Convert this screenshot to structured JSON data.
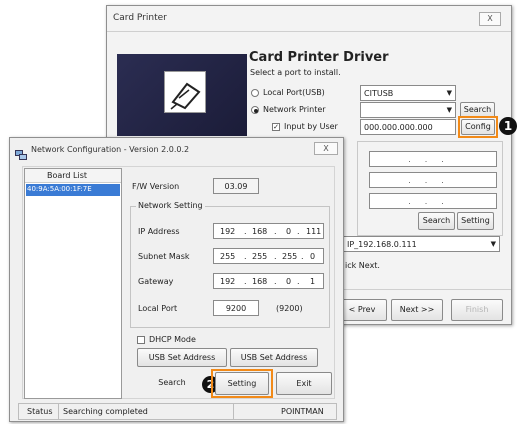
{
  "card_printer": {
    "title": "Card Printer",
    "close": "X",
    "heading": "Card Printer Driver",
    "subheading": "Select a port to install.",
    "local_port_label": "Local Port(USB)",
    "local_port_value": "CITUSB",
    "network_printer_label": "Network Printer",
    "network_printer_value": "",
    "search_button": "Search",
    "input_by_user_label": "Input by User",
    "input_by_user_value": "000.000.000.000",
    "config_button": "Config",
    "search_button_2": "Search",
    "setting_button": "Setting",
    "port_select_value": "IP_192.168.0.111",
    "hint": "ick Next.",
    "prev_button": "< Prev",
    "next_button": "Next >>",
    "finish_button": "Finish",
    "marker": "1"
  },
  "network_config": {
    "title": "Network Configuration - Version 2.0.0.2",
    "close": "X",
    "board_list_header": "Board List",
    "board_list_item": "40:9A:5A:00:1F:7E",
    "fw_version_label": "F/W Version",
    "fw_version_value": "03.09",
    "network_setting_group": "Network Setting",
    "ip_label": "IP Address",
    "ip": [
      "192",
      "168",
      "0",
      "111"
    ],
    "subnet_label": "Subnet Mask",
    "subnet": [
      "255",
      "255",
      "255",
      "0"
    ],
    "gateway_label": "Gateway",
    "gateway": [
      "192",
      "168",
      "0",
      "1"
    ],
    "local_port_label": "Local Port",
    "local_port_value": "9200",
    "local_port_default": "(9200)",
    "dhcp_label": "DHCP Mode",
    "usb_set_address_1": "USB Set Address",
    "usb_set_address_2": "USB Set Address",
    "search_button": "Search",
    "setting_button": "Setting",
    "exit_button": "Exit",
    "marker": "2",
    "status_label": "Status",
    "status_value": "Searching completed",
    "status_right": "POINTMAN"
  }
}
